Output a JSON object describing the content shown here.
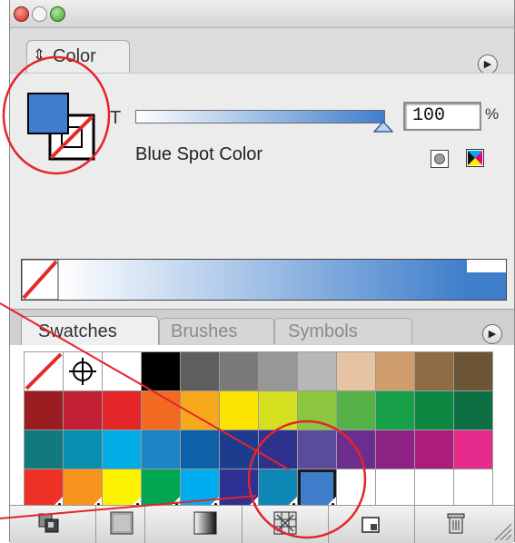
{
  "color_panel": {
    "tab_label": "Color",
    "menu_glyph": "▶",
    "slider_letter": "T",
    "tint_value": "100",
    "tint_unit": "%",
    "tint_fraction": 1.0,
    "color_name": "Blue Spot Color",
    "fill_color": "#3f7ecb"
  },
  "swatches_panel": {
    "tabs": [
      {
        "label": "Swatches",
        "active": true
      },
      {
        "label": "Brushes",
        "active": false
      },
      {
        "label": "Symbols",
        "active": false
      }
    ],
    "menu_glyph": "▶",
    "rows": [
      [
        "none",
        "registration",
        "#ffffff",
        "#000000",
        "#5e5e5e",
        "#7a7a7a",
        "#979797",
        "#b7b7b7",
        "#e5c3a3",
        "#cf9d6c",
        "#8f6c44",
        "#6b5535"
      ],
      [
        "#9a1d21",
        "#c21f35",
        "#e42628",
        "#f26a21",
        "#f7a81c",
        "#fde300",
        "#d3df1f",
        "#8cc53e",
        "#56b248",
        "#18a049",
        "#0c8843",
        "#0c7042"
      ],
      [
        "#107a7f",
        "#078fb0",
        "#00aee5",
        "#1b84c5",
        "#0d62a7",
        "#1e3c8e",
        "#2e328d",
        "#5b4b9d",
        "#6b2e8f",
        "#8e2385",
        "#ac1d7b",
        "#e62b8c"
      ],
      [
        "spot:#ee3124",
        "spot:#f7941d",
        "spot:#fff200",
        "spot:#00a651",
        "spot:#00aeef",
        "spot:#2e3192",
        "spot:#0e87b4",
        "spot:#3f7ecb",
        "empty",
        "empty",
        "empty",
        "empty"
      ]
    ]
  },
  "icons": {
    "titlebar_buttons": [
      "close-icon",
      "minimize-icon",
      "zoom-icon"
    ],
    "bottom_buttons": [
      "swatch-libraries-icon",
      "show-swatch-kinds-icon",
      "swatch-options-icon",
      "new-color-group-icon",
      "new-swatch-icon",
      "delete-swatch-icon"
    ]
  }
}
